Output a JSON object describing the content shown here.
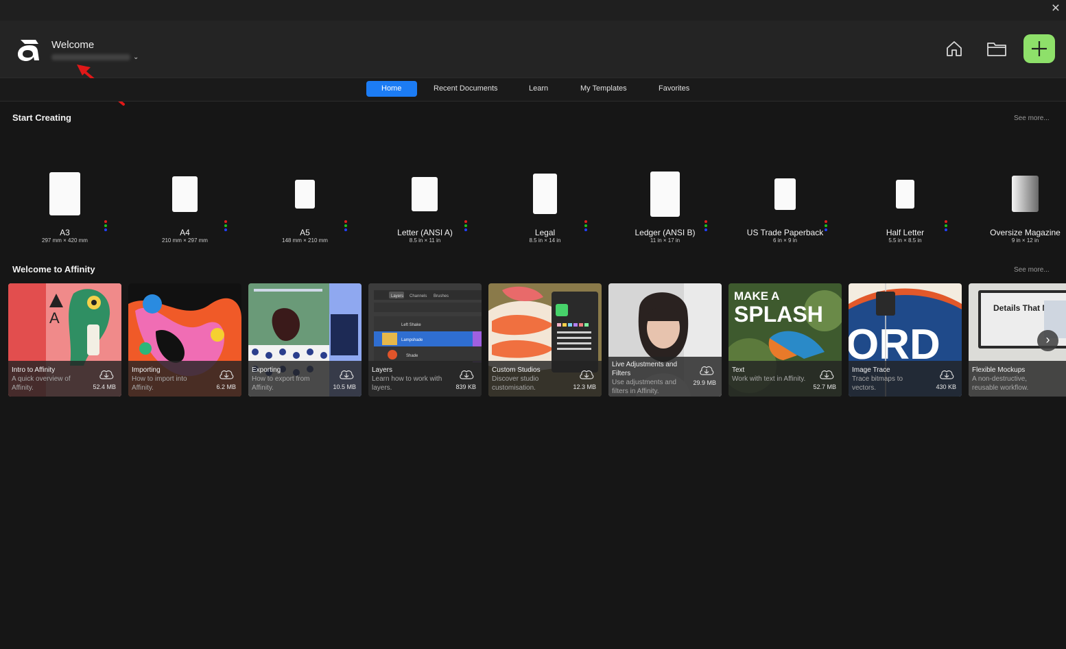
{
  "header": {
    "welcome_title": "Welcome"
  },
  "tabs": [
    "Home",
    "Recent Documents",
    "Learn",
    "My Templates",
    "Favorites"
  ],
  "start_creating": {
    "title": "Start Creating",
    "see_more": "See more...",
    "presets": [
      {
        "name": "A3",
        "dims": "297 mm × 420 mm"
      },
      {
        "name": "A4",
        "dims": "210 mm × 297 mm"
      },
      {
        "name": "A5",
        "dims": "148 mm × 210 mm"
      },
      {
        "name": "Letter (ANSI A)",
        "dims": "8.5 in × 11 in"
      },
      {
        "name": "Legal",
        "dims": "8.5 in × 14 in"
      },
      {
        "name": "Ledger (ANSI B)",
        "dims": "11 in × 17 in"
      },
      {
        "name": "US Trade Paperback",
        "dims": "6 in × 9 in"
      },
      {
        "name": "Half Letter",
        "dims": "5.5 in × 8.5 in"
      },
      {
        "name": "Oversize Magazine",
        "dims": "9 in × 12 in"
      }
    ],
    "color_dots": [
      "#e02020",
      "#20c020",
      "#2040ff"
    ]
  },
  "welcome": {
    "title": "Welcome to Affinity",
    "see_more": "See more...",
    "cards": [
      {
        "title": "Intro to Affinity",
        "desc": "A quick overview of Affinity.",
        "size": "52.4 MB"
      },
      {
        "title": "Importing",
        "desc": "How to import into Affinity.",
        "size": "6.2 MB"
      },
      {
        "title": "Exporting",
        "desc": "How to export from Affinity.",
        "size": "10.5 MB"
      },
      {
        "title": "Layers",
        "desc": "Learn how to work with layers.",
        "size": "839 KB"
      },
      {
        "title": "Custom Studios",
        "desc": "Discover studio customisation.",
        "size": "12.3 MB"
      },
      {
        "title": "Live Adjustments and Filters",
        "desc": "Use adjustments and filters in Affinity.",
        "size": "29.9 MB"
      },
      {
        "title": "Text",
        "desc": "Work with text in Affinity.",
        "size": "52.7 MB"
      },
      {
        "title": "Image Trace",
        "desc": "Trace bitmaps to vectors.",
        "size": "430 KB"
      },
      {
        "title": "Flexible Mockups",
        "desc": "A non-destructive, reusable workflow.",
        "size": ""
      }
    ],
    "art_text": {
      "splash_line1": "MAKE A",
      "splash_line2": "SPLASH",
      "mockup": "Details That Matter",
      "trace": "ORD",
      "layers_tabs": [
        "Layers",
        "Channels",
        "Brushes"
      ],
      "layers_rows": [
        "Left Shake",
        "Lampshade",
        "Shade"
      ]
    }
  },
  "colors": {
    "accent": "#1c7cf4",
    "new_button": "#8ee06a",
    "annotation_arrow": "#e01818"
  }
}
